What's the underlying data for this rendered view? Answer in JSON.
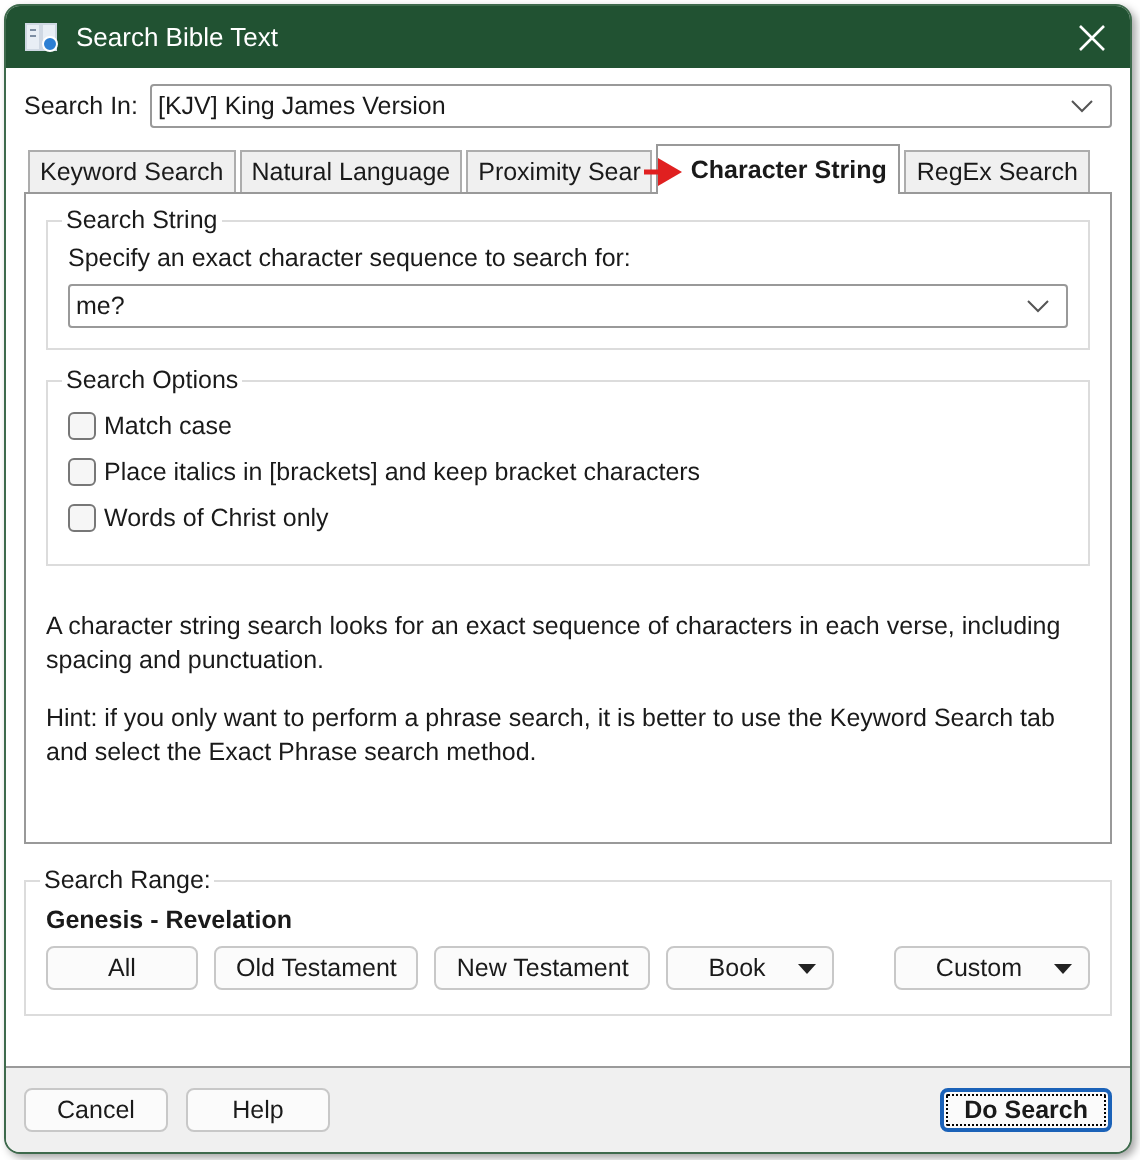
{
  "window": {
    "title": "Search Bible Text"
  },
  "search_in": {
    "label": "Search In:",
    "value": "[KJV] King James Version"
  },
  "tabs": [
    {
      "label": "Keyword Search",
      "selected": false
    },
    {
      "label": "Natural Language",
      "selected": false
    },
    {
      "label": "Proximity Sear",
      "selected": false
    },
    {
      "label": "Character String",
      "selected": true
    },
    {
      "label": "RegEx Search",
      "selected": false
    }
  ],
  "search_string": {
    "legend": "Search String",
    "prompt": "Specify an exact character sequence to search for:",
    "value": "me?"
  },
  "search_options": {
    "legend": "Search Options",
    "options": [
      {
        "label": "Match case",
        "checked": false
      },
      {
        "label": "Place italics in [brackets] and keep bracket characters",
        "checked": false
      },
      {
        "label": "Words of Christ only",
        "checked": false
      }
    ]
  },
  "description": [
    "A character string search looks for an exact sequence of characters in each verse, including spacing and punctuation.",
    "Hint: if you only want to perform a phrase search, it is better to use the Keyword Search tab and select the Exact Phrase search method."
  ],
  "search_range": {
    "legend": "Search Range:",
    "range": "Genesis - Revelation",
    "buttons": [
      {
        "label": "All",
        "kind": "plain"
      },
      {
        "label": "Old Testament",
        "kind": "plain"
      },
      {
        "label": "New Testament",
        "kind": "plain"
      },
      {
        "label": "Book",
        "kind": "dropdown"
      },
      {
        "label": "Custom",
        "kind": "dropdown"
      }
    ]
  },
  "footer_buttons": [
    {
      "label": "Cancel",
      "default": false
    },
    {
      "label": "Help",
      "default": false
    },
    {
      "label": "Do Search",
      "default": true
    }
  ]
}
